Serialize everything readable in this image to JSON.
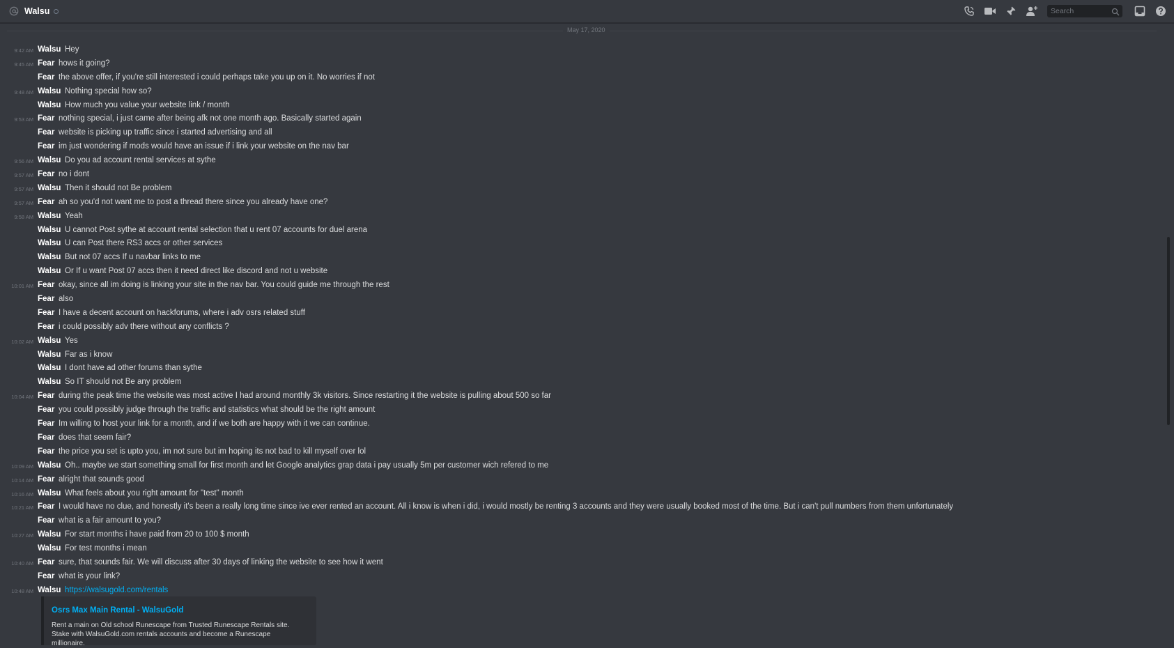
{
  "header": {
    "channel_name": "Walsu",
    "icons": [
      "at-icon",
      "call-icon",
      "video-icon",
      "pin-icon",
      "add-friend-icon",
      "search-icon",
      "inbox-icon",
      "help-icon"
    ],
    "search_placeholder": "Search"
  },
  "divider": {
    "date": "May 17, 2020"
  },
  "colors": {
    "background": "#36393f",
    "header_text": "#ffffff",
    "link": "#00b0f4",
    "muted": "#72767d"
  },
  "messages": [
    {
      "time": "9:42 AM",
      "author": "Walsu",
      "text": "Hey"
    },
    {
      "time": "9:45 AM",
      "author": "Fear",
      "text": "hows it going?"
    },
    {
      "time": "",
      "author": "Fear",
      "text": "the above offer, if you're still interested i could perhaps take you up on it. No worries if not"
    },
    {
      "time": "9:48 AM",
      "author": "Walsu",
      "text": "Nothing special how so?"
    },
    {
      "time": "",
      "author": "Walsu",
      "text": "How much you value your website link / month"
    },
    {
      "time": "9:53 AM",
      "author": "Fear",
      "text": "nothing special, i just came after being afk not one month ago. Basically started again"
    },
    {
      "time": "",
      "author": "Fear",
      "text": "website is picking up traffic since i started advertising and all"
    },
    {
      "time": "",
      "author": "Fear",
      "text": "im just wondering if mods would have an issue if i link your website on the nav bar"
    },
    {
      "time": "9:56 AM",
      "author": "Walsu",
      "text": "Do you ad account rental services at sythe"
    },
    {
      "time": "9:57 AM",
      "author": "Fear",
      "text": "no i dont"
    },
    {
      "time": "9:57 AM",
      "author": "Walsu",
      "text": "Then it should not Be problem"
    },
    {
      "time": "9:57 AM",
      "author": "Fear",
      "text": "ah so you'd not want me to post a thread there since you already have one?"
    },
    {
      "time": "9:58 AM",
      "author": "Walsu",
      "text": "Yeah"
    },
    {
      "time": "",
      "author": "Walsu",
      "text": "U cannot Post sythe at account rental selection that u rent 07 accounts for duel arena"
    },
    {
      "time": "",
      "author": "Walsu",
      "text": "U can Post there RS3 accs or other services"
    },
    {
      "time": "",
      "author": "Walsu",
      "text": "But not 07 accs If u navbar links to me"
    },
    {
      "time": "",
      "author": "Walsu",
      "text": "Or If u want Post 07 accs then it need direct like discord and not u website"
    },
    {
      "time": "10:01 AM",
      "author": "Fear",
      "text": "okay, since all im doing is linking your site in the nav bar. You could guide me through the rest"
    },
    {
      "time": "",
      "author": "Fear",
      "text": "also"
    },
    {
      "time": "",
      "author": "Fear",
      "text": "I have a decent account on hackforums, where i adv osrs related stuff"
    },
    {
      "time": "",
      "author": "Fear",
      "text": "i could possibly adv there without any conflicts ?"
    },
    {
      "time": "10:02 AM",
      "author": "Walsu",
      "text": "Yes"
    },
    {
      "time": "",
      "author": "Walsu",
      "text": "Far as i know"
    },
    {
      "time": "",
      "author": "Walsu",
      "text": "I dont have ad other forums than sythe"
    },
    {
      "time": "",
      "author": "Walsu",
      "text": "So IT should not Be any problem"
    },
    {
      "time": "10:04 AM",
      "author": "Fear",
      "text": "during the peak time the website was most active I had around monthly 3k visitors. Since restarting it the website is pulling about 500 so far"
    },
    {
      "time": "",
      "author": "Fear",
      "text": "you could possibly judge through the traffic and statistics what should be the right amount"
    },
    {
      "time": "",
      "author": "Fear",
      "text": "Im willing to host your link for a month, and if we both are happy with it we can continue."
    },
    {
      "time": "",
      "author": "Fear",
      "text": "does that seem fair?"
    },
    {
      "time": "",
      "author": "Fear",
      "text": "the price you set is upto you, im not sure but im hoping its not bad to kill myself over lol"
    },
    {
      "time": "10:09 AM",
      "author": "Walsu",
      "text": "Oh.. maybe we start something small for first month and let Google analytics grap data i pay usually 5m per customer wich refered to me"
    },
    {
      "time": "10:14 AM",
      "author": "Fear",
      "text": "alright that sounds good"
    },
    {
      "time": "10:16 AM",
      "author": "Walsu",
      "text": "What feels about you right amount for \"test\" month"
    },
    {
      "time": "10:21 AM",
      "author": "Fear",
      "text": "I would have no clue, and honestly it's been a really long time since ive ever rented an account. All i know is when i did, i would mostly be renting 3 accounts and they were usually booked most of the time. But i can't pull numbers from them unfortunately"
    },
    {
      "time": "",
      "author": "Fear",
      "text": "what is a fair amount to you?"
    },
    {
      "time": "10:27 AM",
      "author": "Walsu",
      "text": "For start months i have paid from 20 to 100 $ month"
    },
    {
      "time": "",
      "author": "Walsu",
      "text": "For test months i mean"
    },
    {
      "time": "10:40 AM",
      "author": "Fear",
      "text": "sure, that sounds fair. We will discuss after 30 days of linking the website to see how it went"
    },
    {
      "time": "",
      "author": "Fear",
      "text": "what is your link?"
    },
    {
      "time": "10:48 AM",
      "author": "Walsu",
      "text": "https://walsugold.com/rentals",
      "is_link": true
    }
  ],
  "embed": {
    "title": "Osrs Max Main Rental - WalsuGold",
    "description": "Rent a main on Old school Runescape from Trusted Runescape Rentals site. Stake with WalsuGold.com rentals accounts and become a Runescape millionaire."
  }
}
